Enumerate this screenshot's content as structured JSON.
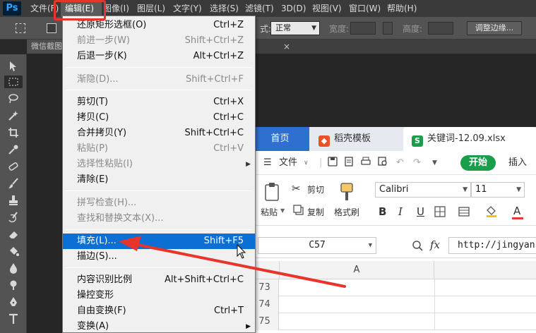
{
  "app": {
    "logo": "Ps"
  },
  "menubar": {
    "items": [
      "文件(F)",
      "编辑(E)",
      "图像(I)",
      "图层(L)",
      "文字(Y)",
      "选择(S)",
      "滤镜(T)",
      "3D(D)",
      "视图(V)",
      "窗口(W)",
      "帮助(H)"
    ],
    "active": "编辑(E)"
  },
  "options": {
    "style_label": "式:",
    "style_value": "正常",
    "width_label": "宽度:",
    "height_label": "高度:",
    "refine_edge_button": "调整边缘..."
  },
  "document": {
    "tab_label": "微信截图",
    "close_label": "×"
  },
  "edit_menu": {
    "items": [
      {
        "label": "还原矩形选框(O)",
        "shortcut": "Ctrl+Z",
        "disabled": false
      },
      {
        "label": "前进一步(W)",
        "shortcut": "Shift+Ctrl+Z",
        "disabled": true
      },
      {
        "label": "后退一步(K)",
        "shortcut": "Alt+Ctrl+Z",
        "disabled": false
      },
      {
        "separator": true
      },
      {
        "label": "渐隐(D)...",
        "shortcut": "Shift+Ctrl+F",
        "disabled": true
      },
      {
        "separator": true
      },
      {
        "label": "剪切(T)",
        "shortcut": "Ctrl+X",
        "disabled": false
      },
      {
        "label": "拷贝(C)",
        "shortcut": "Ctrl+C",
        "disabled": false
      },
      {
        "label": "合并拷贝(Y)",
        "shortcut": "Shift+Ctrl+C",
        "disabled": false
      },
      {
        "label": "粘贴(P)",
        "shortcut": "Ctrl+V",
        "disabled": true
      },
      {
        "label": "选择性粘贴(I)",
        "shortcut": "",
        "disabled": true,
        "submenu": true
      },
      {
        "label": "清除(E)",
        "shortcut": "",
        "disabled": false
      },
      {
        "separator": true
      },
      {
        "label": "拼写检查(H)...",
        "shortcut": "",
        "disabled": true
      },
      {
        "label": "查找和替换文本(X)...",
        "shortcut": "",
        "disabled": true
      },
      {
        "separator": true
      },
      {
        "label": "填充(L)...",
        "shortcut": "Shift+F5",
        "disabled": false,
        "highlighted": true
      },
      {
        "label": "描边(S)...",
        "shortcut": "",
        "disabled": false
      },
      {
        "separator": true
      },
      {
        "label": "内容识别比例",
        "shortcut": "Alt+Shift+Ctrl+C",
        "disabled": false
      },
      {
        "label": "操控变形",
        "shortcut": "",
        "disabled": false
      },
      {
        "label": "自由变换(F)",
        "shortcut": "Ctrl+T",
        "disabled": false
      },
      {
        "label": "变换(A)",
        "shortcut": "",
        "disabled": false,
        "submenu": true
      }
    ],
    "submenu_glyph": "▶"
  },
  "wps": {
    "tabs": {
      "home": "首页",
      "template": "稻壳模板",
      "file": "关键词-12.09.xlsx",
      "template_icon": "◆",
      "file_icon": "S"
    },
    "menu": {
      "file_menu": "文件",
      "start_button": "开始",
      "insert": "插入"
    },
    "ribbon": {
      "paste": "粘贴",
      "cut": "剪切",
      "copy": "复制",
      "format_painter": "格式刷",
      "font_name": "Calibri",
      "font_size": "11",
      "bold": "B",
      "italic": "I",
      "underline": "U",
      "font_color_letter": "A"
    },
    "formula_bar": {
      "name_box": "C57",
      "fx": "fx",
      "formula": "http://jingyan"
    },
    "grid": {
      "column": "A",
      "rows": [
        "73",
        "74",
        "75"
      ]
    }
  },
  "colors": {
    "accent_red": "#e8342b",
    "highlight_blue": "#0b6fd3",
    "wps_blue": "#2e6fd0",
    "wps_green": "#1b9e4b"
  }
}
